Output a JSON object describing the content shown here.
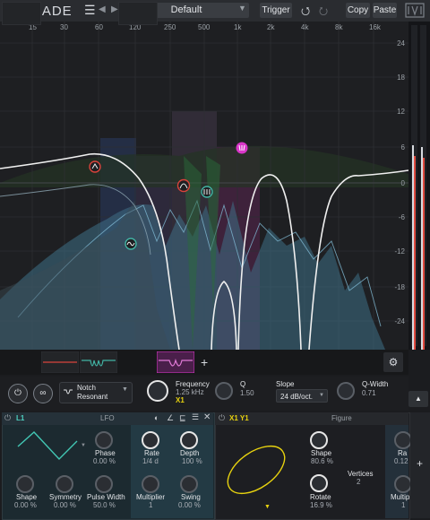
{
  "topbar": {
    "brand": "SHADE",
    "menu_icon": "hamburger-icon",
    "preset": "Default",
    "trigger": "Trigger",
    "copy": "Copy",
    "paste": "Paste"
  },
  "graph": {
    "freq_labels": [
      "15",
      "30",
      "60",
      "120",
      "250",
      "500",
      "1k",
      "2k",
      "4k",
      "8k",
      "16k"
    ],
    "db_labels": [
      "24",
      "18",
      "12",
      "6",
      "0",
      "-6",
      "-12",
      "-18",
      "-24"
    ]
  },
  "band": {
    "filter_type_line1": "Notch",
    "filter_type_line2": "Resonant",
    "frequency_label": "Frequency",
    "frequency_value": "1.25 kHz",
    "frequency_mod": "X1",
    "q_label": "Q",
    "q_value": "1.50",
    "slope_label": "Slope",
    "slope_value": "24 dB/oct.",
    "qwidth_label": "Q-Width",
    "qwidth_value": "0.71"
  },
  "lfo": {
    "tag": "L1",
    "title": "LFO",
    "phase_label": "Phase",
    "phase_value": "0.00 %",
    "rate_label": "Rate",
    "rate_value": "1/4 d",
    "depth_label": "Depth",
    "depth_value": "100 %",
    "shape_label": "Shape",
    "shape_value": "0.00 %",
    "symmetry_label": "Symmetry",
    "symmetry_value": "0.00 %",
    "pulsewidth_label": "Pulse Width",
    "pulsewidth_value": "50.0 %",
    "multiplier_label": "Multiplier",
    "multiplier_value": "1",
    "swing_label": "Swing",
    "swing_value": "0.00 %"
  },
  "figure": {
    "tag": "X1 Y1",
    "title": "Figure",
    "shape_label": "Shape",
    "shape_value": "80.6 %",
    "vertices_label": "Vertices",
    "vertices_value": "2",
    "rotate_label": "Rotate",
    "rotate_value": "16.9 %",
    "rate_label": "Ra",
    "rate_value": "0.12",
    "multiplier_label": "Multip",
    "multiplier_value": "1"
  },
  "colors": {
    "accent_yellow": "#e7d20f",
    "accent_magenta": "#d936c8",
    "accent_red": "#d9433b",
    "accent_teal": "#42b3a3",
    "spectrum_blue": "#5aa7c7"
  }
}
